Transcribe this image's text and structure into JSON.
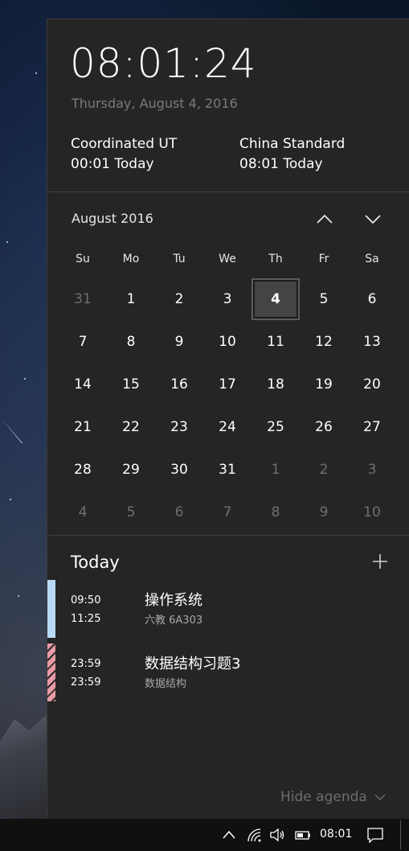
{
  "clock": {
    "time": "08:01:24",
    "date": "Thursday, August 4, 2016"
  },
  "timezones": [
    {
      "name": "Coordinated UT",
      "time": "00:01 Today"
    },
    {
      "name": "China Standard",
      "time": "08:01 Today"
    }
  ],
  "calendar": {
    "month_label": "August 2016",
    "weekdays": [
      "Su",
      "Mo",
      "Tu",
      "We",
      "Th",
      "Fr",
      "Sa"
    ],
    "weeks": [
      [
        "31",
        "1",
        "2",
        "3",
        "4",
        "5",
        "6"
      ],
      [
        "7",
        "8",
        "9",
        "10",
        "11",
        "12",
        "13"
      ],
      [
        "14",
        "15",
        "16",
        "17",
        "18",
        "19",
        "20"
      ],
      [
        "21",
        "22",
        "23",
        "24",
        "25",
        "26",
        "27"
      ],
      [
        "28",
        "29",
        "30",
        "31",
        "1",
        "2",
        "3"
      ],
      [
        "4",
        "5",
        "6",
        "7",
        "8",
        "9",
        "10"
      ]
    ],
    "selected_day": "4",
    "up_icon": "chevron-up-icon",
    "down_icon": "chevron-down-icon"
  },
  "agenda": {
    "title": "Today",
    "add_icon": "plus-icon",
    "events": [
      {
        "start": "09:50",
        "end": "11:25",
        "title": "操作系统",
        "location": "六教 6A303",
        "color": "#b7dbf7"
      },
      {
        "start": "23:59",
        "end": "23:59",
        "title": "数据结构习题3",
        "location": "数据结构",
        "color": "#e99aa5"
      }
    ],
    "hide_label": "Hide agenda"
  },
  "taskbar": {
    "clock": "08:01",
    "icons": [
      "chevron-up-icon",
      "wifi-icon",
      "volume-icon",
      "battery-icon",
      "action-center-icon"
    ]
  }
}
